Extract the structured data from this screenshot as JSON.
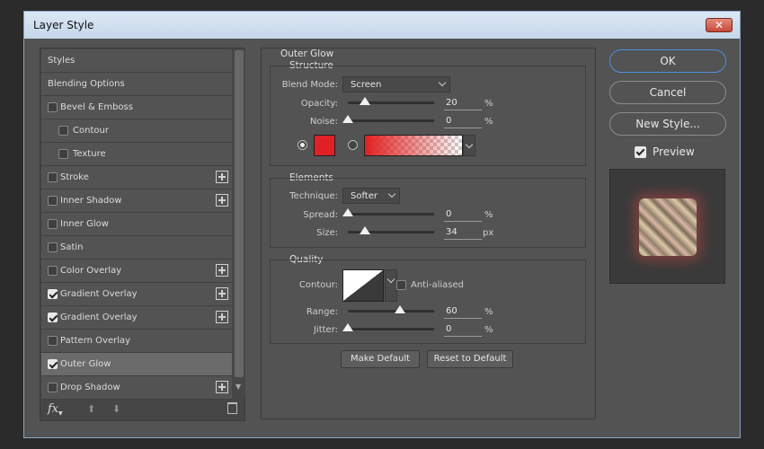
{
  "window": {
    "title": "Layer Style",
    "close_label": "✕"
  },
  "style_list": {
    "items": [
      {
        "label": "Styles",
        "has_checkbox": false,
        "checked": false,
        "has_plus": false,
        "indent": false,
        "active": false
      },
      {
        "label": "Blending Options",
        "has_checkbox": false,
        "checked": false,
        "has_plus": false,
        "indent": false,
        "active": false
      },
      {
        "label": "Bevel & Emboss",
        "has_checkbox": true,
        "checked": false,
        "has_plus": false,
        "indent": false,
        "active": false
      },
      {
        "label": "Contour",
        "has_checkbox": true,
        "checked": false,
        "has_plus": false,
        "indent": true,
        "active": false
      },
      {
        "label": "Texture",
        "has_checkbox": true,
        "checked": false,
        "has_plus": false,
        "indent": true,
        "active": false
      },
      {
        "label": "Stroke",
        "has_checkbox": true,
        "checked": false,
        "has_plus": true,
        "indent": false,
        "active": false
      },
      {
        "label": "Inner Shadow",
        "has_checkbox": true,
        "checked": false,
        "has_plus": true,
        "indent": false,
        "active": false
      },
      {
        "label": "Inner Glow",
        "has_checkbox": true,
        "checked": false,
        "has_plus": false,
        "indent": false,
        "active": false
      },
      {
        "label": "Satin",
        "has_checkbox": true,
        "checked": false,
        "has_plus": false,
        "indent": false,
        "active": false
      },
      {
        "label": "Color Overlay",
        "has_checkbox": true,
        "checked": false,
        "has_plus": true,
        "indent": false,
        "active": false
      },
      {
        "label": "Gradient Overlay",
        "has_checkbox": true,
        "checked": true,
        "has_plus": true,
        "indent": false,
        "active": false
      },
      {
        "label": "Gradient Overlay",
        "has_checkbox": true,
        "checked": true,
        "has_plus": true,
        "indent": false,
        "active": false
      },
      {
        "label": "Pattern Overlay",
        "has_checkbox": true,
        "checked": false,
        "has_plus": false,
        "indent": false,
        "active": false
      },
      {
        "label": "Outer Glow",
        "has_checkbox": true,
        "checked": true,
        "has_plus": false,
        "indent": false,
        "active": true
      },
      {
        "label": "Drop Shadow",
        "has_checkbox": true,
        "checked": false,
        "has_plus": true,
        "indent": false,
        "active": false
      }
    ],
    "fx_label": "fx"
  },
  "outer_glow": {
    "section_title": "Outer Glow",
    "structure": {
      "title": "Structure",
      "blend_mode_label": "Blend Mode:",
      "blend_mode_value": "Screen",
      "opacity_label": "Opacity:",
      "opacity_value": "20",
      "opacity_unit": "%",
      "opacity_level": 0.2,
      "noise_label": "Noise:",
      "noise_value": "0",
      "noise_unit": "%",
      "noise_level": 0.0,
      "glow_color": "#e01f26"
    },
    "elements": {
      "title": "Elements",
      "technique_label": "Technique:",
      "technique_value": "Softer",
      "spread_label": "Spread:",
      "spread_value": "0",
      "spread_unit": "%",
      "spread_level": 0.0,
      "size_label": "Size:",
      "size_value": "34",
      "size_unit": "px",
      "size_level": 0.2
    },
    "quality": {
      "title": "Quality",
      "contour_label": "Contour:",
      "anti_aliased_label": "Anti-aliased",
      "range_label": "Range:",
      "range_value": "60",
      "range_unit": "%",
      "range_level": 0.6,
      "jitter_label": "Jitter:",
      "jitter_value": "0",
      "jitter_unit": "%",
      "jitter_level": 0.0
    },
    "make_default_label": "Make Default",
    "reset_default_label": "Reset to Default"
  },
  "actions": {
    "ok_label": "OK",
    "cancel_label": "Cancel",
    "new_style_label": "New Style...",
    "preview_label": "Preview"
  }
}
